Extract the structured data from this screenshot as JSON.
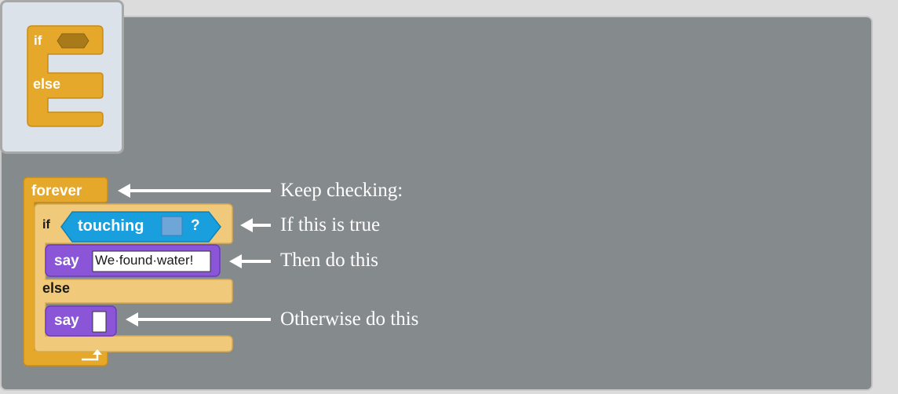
{
  "palette": {
    "if_label": "if",
    "else_label": "else"
  },
  "script": {
    "forever_label": "forever",
    "if_label": "if",
    "touching_label": "touching",
    "question_mark": "?",
    "say1_label": "say",
    "say1_text": "We·found·water!",
    "else_label": "else",
    "say2_label": "say",
    "say2_text": "",
    "loop_icon": "loop-arrow-icon"
  },
  "annotations": [
    "Keep checking:",
    "If this is true",
    "Then do this",
    "Otherwise do this"
  ],
  "colors": {
    "control": "#e6a82a",
    "control_light": "#f0c97a",
    "looks": "#8a55d7",
    "sensing": "#1a9fde",
    "workspace": "#858a8c",
    "palette": "#dbe2ea"
  }
}
